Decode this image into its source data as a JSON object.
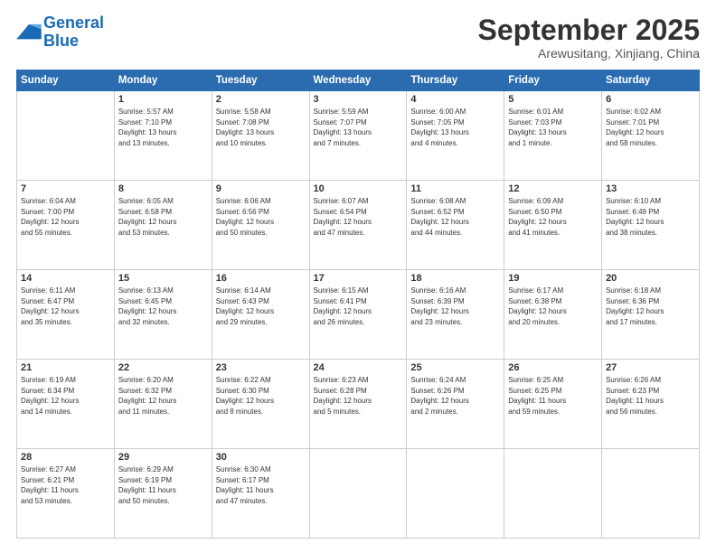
{
  "header": {
    "logo_line1": "General",
    "logo_line2": "Blue",
    "month": "September 2025",
    "location": "Arewusitang, Xinjiang, China"
  },
  "weekdays": [
    "Sunday",
    "Monday",
    "Tuesday",
    "Wednesday",
    "Thursday",
    "Friday",
    "Saturday"
  ],
  "weeks": [
    [
      {
        "day": "",
        "info": ""
      },
      {
        "day": "1",
        "info": "Sunrise: 5:57 AM\nSunset: 7:10 PM\nDaylight: 13 hours\nand 13 minutes."
      },
      {
        "day": "2",
        "info": "Sunrise: 5:58 AM\nSunset: 7:08 PM\nDaylight: 13 hours\nand 10 minutes."
      },
      {
        "day": "3",
        "info": "Sunrise: 5:59 AM\nSunset: 7:07 PM\nDaylight: 13 hours\nand 7 minutes."
      },
      {
        "day": "4",
        "info": "Sunrise: 6:00 AM\nSunset: 7:05 PM\nDaylight: 13 hours\nand 4 minutes."
      },
      {
        "day": "5",
        "info": "Sunrise: 6:01 AM\nSunset: 7:03 PM\nDaylight: 13 hours\nand 1 minute."
      },
      {
        "day": "6",
        "info": "Sunrise: 6:02 AM\nSunset: 7:01 PM\nDaylight: 12 hours\nand 58 minutes."
      }
    ],
    [
      {
        "day": "7",
        "info": "Sunrise: 6:04 AM\nSunset: 7:00 PM\nDaylight: 12 hours\nand 55 minutes."
      },
      {
        "day": "8",
        "info": "Sunrise: 6:05 AM\nSunset: 6:58 PM\nDaylight: 12 hours\nand 53 minutes."
      },
      {
        "day": "9",
        "info": "Sunrise: 6:06 AM\nSunset: 6:56 PM\nDaylight: 12 hours\nand 50 minutes."
      },
      {
        "day": "10",
        "info": "Sunrise: 6:07 AM\nSunset: 6:54 PM\nDaylight: 12 hours\nand 47 minutes."
      },
      {
        "day": "11",
        "info": "Sunrise: 6:08 AM\nSunset: 6:52 PM\nDaylight: 12 hours\nand 44 minutes."
      },
      {
        "day": "12",
        "info": "Sunrise: 6:09 AM\nSunset: 6:50 PM\nDaylight: 12 hours\nand 41 minutes."
      },
      {
        "day": "13",
        "info": "Sunrise: 6:10 AM\nSunset: 6:49 PM\nDaylight: 12 hours\nand 38 minutes."
      }
    ],
    [
      {
        "day": "14",
        "info": "Sunrise: 6:11 AM\nSunset: 6:47 PM\nDaylight: 12 hours\nand 35 minutes."
      },
      {
        "day": "15",
        "info": "Sunrise: 6:13 AM\nSunset: 6:45 PM\nDaylight: 12 hours\nand 32 minutes."
      },
      {
        "day": "16",
        "info": "Sunrise: 6:14 AM\nSunset: 6:43 PM\nDaylight: 12 hours\nand 29 minutes."
      },
      {
        "day": "17",
        "info": "Sunrise: 6:15 AM\nSunset: 6:41 PM\nDaylight: 12 hours\nand 26 minutes."
      },
      {
        "day": "18",
        "info": "Sunrise: 6:16 AM\nSunset: 6:39 PM\nDaylight: 12 hours\nand 23 minutes."
      },
      {
        "day": "19",
        "info": "Sunrise: 6:17 AM\nSunset: 6:38 PM\nDaylight: 12 hours\nand 20 minutes."
      },
      {
        "day": "20",
        "info": "Sunrise: 6:18 AM\nSunset: 6:36 PM\nDaylight: 12 hours\nand 17 minutes."
      }
    ],
    [
      {
        "day": "21",
        "info": "Sunrise: 6:19 AM\nSunset: 6:34 PM\nDaylight: 12 hours\nand 14 minutes."
      },
      {
        "day": "22",
        "info": "Sunrise: 6:20 AM\nSunset: 6:32 PM\nDaylight: 12 hours\nand 11 minutes."
      },
      {
        "day": "23",
        "info": "Sunrise: 6:22 AM\nSunset: 6:30 PM\nDaylight: 12 hours\nand 8 minutes."
      },
      {
        "day": "24",
        "info": "Sunrise: 6:23 AM\nSunset: 6:28 PM\nDaylight: 12 hours\nand 5 minutes."
      },
      {
        "day": "25",
        "info": "Sunrise: 6:24 AM\nSunset: 6:26 PM\nDaylight: 12 hours\nand 2 minutes."
      },
      {
        "day": "26",
        "info": "Sunrise: 6:25 AM\nSunset: 6:25 PM\nDaylight: 11 hours\nand 59 minutes."
      },
      {
        "day": "27",
        "info": "Sunrise: 6:26 AM\nSunset: 6:23 PM\nDaylight: 11 hours\nand 56 minutes."
      }
    ],
    [
      {
        "day": "28",
        "info": "Sunrise: 6:27 AM\nSunset: 6:21 PM\nDaylight: 11 hours\nand 53 minutes."
      },
      {
        "day": "29",
        "info": "Sunrise: 6:29 AM\nSunset: 6:19 PM\nDaylight: 11 hours\nand 50 minutes."
      },
      {
        "day": "30",
        "info": "Sunrise: 6:30 AM\nSunset: 6:17 PM\nDaylight: 11 hours\nand 47 minutes."
      },
      {
        "day": "",
        "info": ""
      },
      {
        "day": "",
        "info": ""
      },
      {
        "day": "",
        "info": ""
      },
      {
        "day": "",
        "info": ""
      }
    ]
  ]
}
